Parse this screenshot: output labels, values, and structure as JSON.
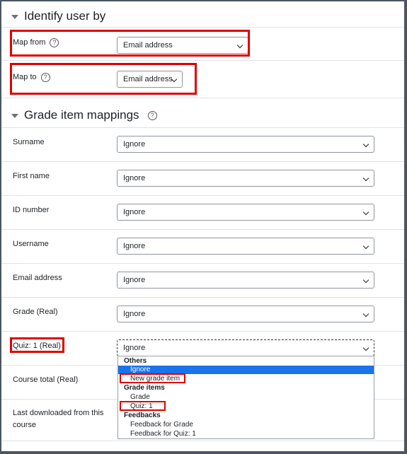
{
  "identify": {
    "title": "Identify user by",
    "map_from_label": "Map from",
    "map_from_value": "Email address",
    "map_to_label": "Map to",
    "map_to_value": "Email address"
  },
  "mappings": {
    "title": "Grade item mappings",
    "rows": [
      {
        "label": "Surname",
        "value": "Ignore"
      },
      {
        "label": "First name",
        "value": "Ignore"
      },
      {
        "label": "ID number",
        "value": "Ignore"
      },
      {
        "label": "Username",
        "value": "Ignore"
      },
      {
        "label": "Email address",
        "value": "Ignore"
      },
      {
        "label": "Grade (Real)",
        "value": "Ignore"
      },
      {
        "label": "Quiz: 1 (Real)",
        "value": "Ignore"
      },
      {
        "label": "Course total (Real)"
      },
      {
        "label_line1": "Last downloaded from this",
        "label_line2": "course"
      }
    ]
  },
  "dropdown": {
    "groups": [
      {
        "name": "Others",
        "options": [
          "Ignore",
          "New grade item"
        ]
      },
      {
        "name": "Grade items",
        "options": [
          "Grade",
          "Quiz: 1"
        ]
      },
      {
        "name": "Feedbacks",
        "options": [
          "Feedback for Grade",
          "Feedback for Quiz: 1"
        ]
      }
    ],
    "selected": "Ignore"
  },
  "icons": {
    "help": "?",
    "collapse": "caret-down",
    "select_arrow": "chevron-down"
  },
  "colors": {
    "highlight": "#e00000",
    "selected_option": "#1a73e8"
  }
}
